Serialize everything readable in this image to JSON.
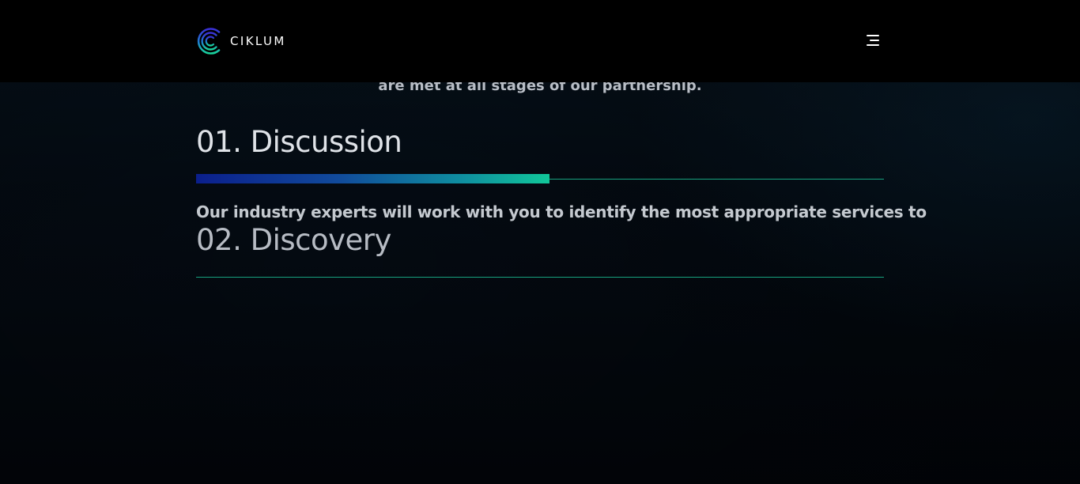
{
  "header": {
    "logo_text": "CIKLUM",
    "menu_icon": "hamburger-menu-icon"
  },
  "intro": {
    "tail_text": "are met at all stages of our partnership."
  },
  "steps": [
    {
      "title": "01. Discussion",
      "description": "Our industry experts will work with you to identify the most appropriate services to",
      "progress": 0.514
    },
    {
      "title": "02. Discovery"
    }
  ],
  "colors": {
    "header_bg": "#000000",
    "accent": "#17a37f",
    "progress_start": "#0b1f8c",
    "progress_end": "#11c79a"
  }
}
